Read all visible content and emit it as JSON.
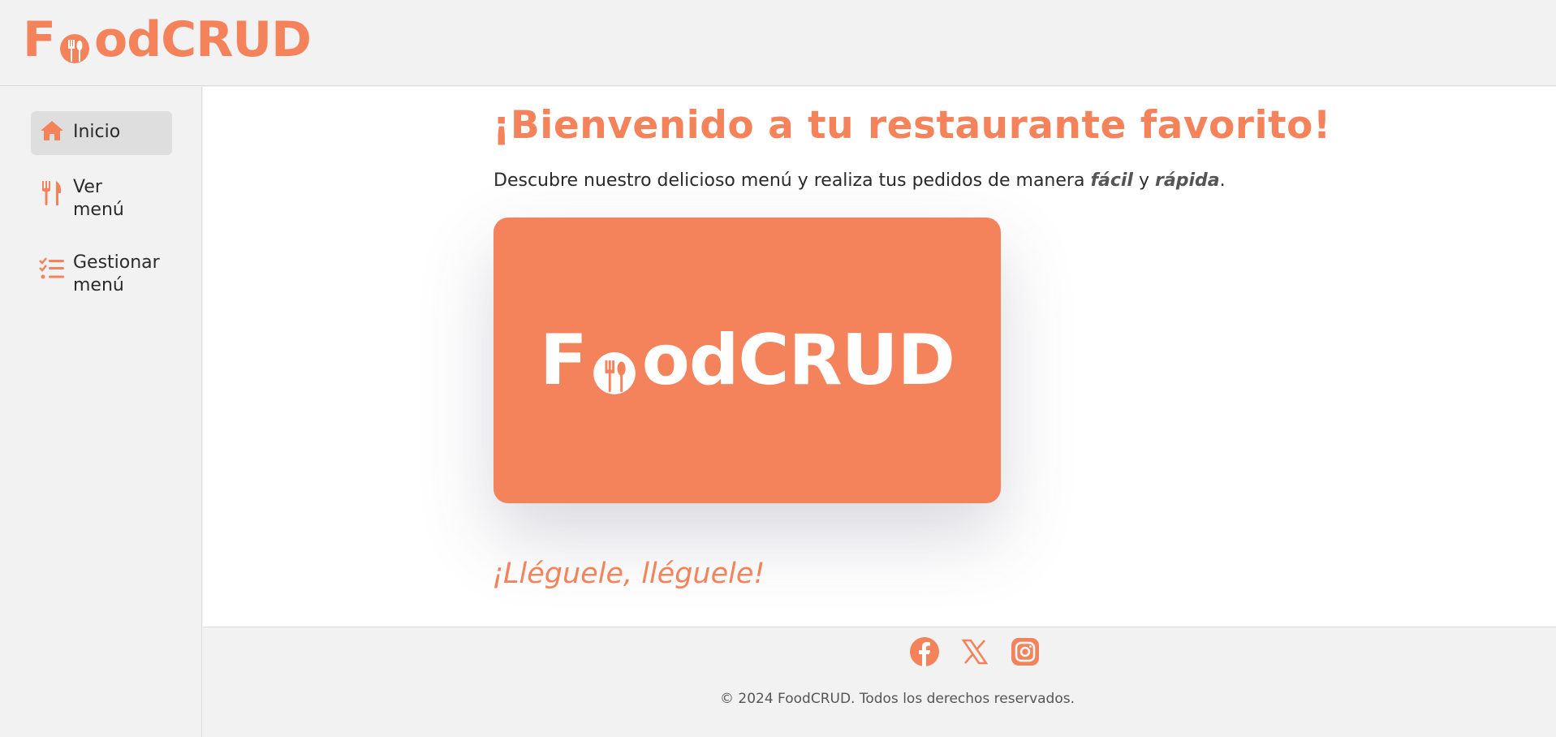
{
  "colors": {
    "accent": "#f4825a",
    "text": "#2b2b2b",
    "background": "#f2f2f2"
  },
  "header": {
    "brand": {
      "part1": "F",
      "part2": "dCRUD"
    }
  },
  "sidebar": {
    "items": [
      {
        "label": "Inicio",
        "icon": "home-icon",
        "active": true
      },
      {
        "label": "Ver menú",
        "icon": "utensils-icon",
        "active": false
      },
      {
        "label": "Gestionar menú",
        "icon": "list-check-icon",
        "active": false
      }
    ]
  },
  "main": {
    "title": "¡Bienvenido a tu restaurante favorito!",
    "intro": {
      "before": "Descubre nuestro delicioso menú y realiza tus pedidos de manera ",
      "emphasis1": "fácil",
      "middle": " y ",
      "emphasis2": "rápida",
      "end": "."
    },
    "hero_logo": {
      "part1": "F",
      "part2": "odCRUD"
    },
    "slogan": "¡Lléguele, lléguele!"
  },
  "footer": {
    "socials": [
      "facebook-icon",
      "x-icon",
      "instagram-icon"
    ],
    "copyright": "© 2024 FoodCRUD. Todos los derechos reservados."
  }
}
